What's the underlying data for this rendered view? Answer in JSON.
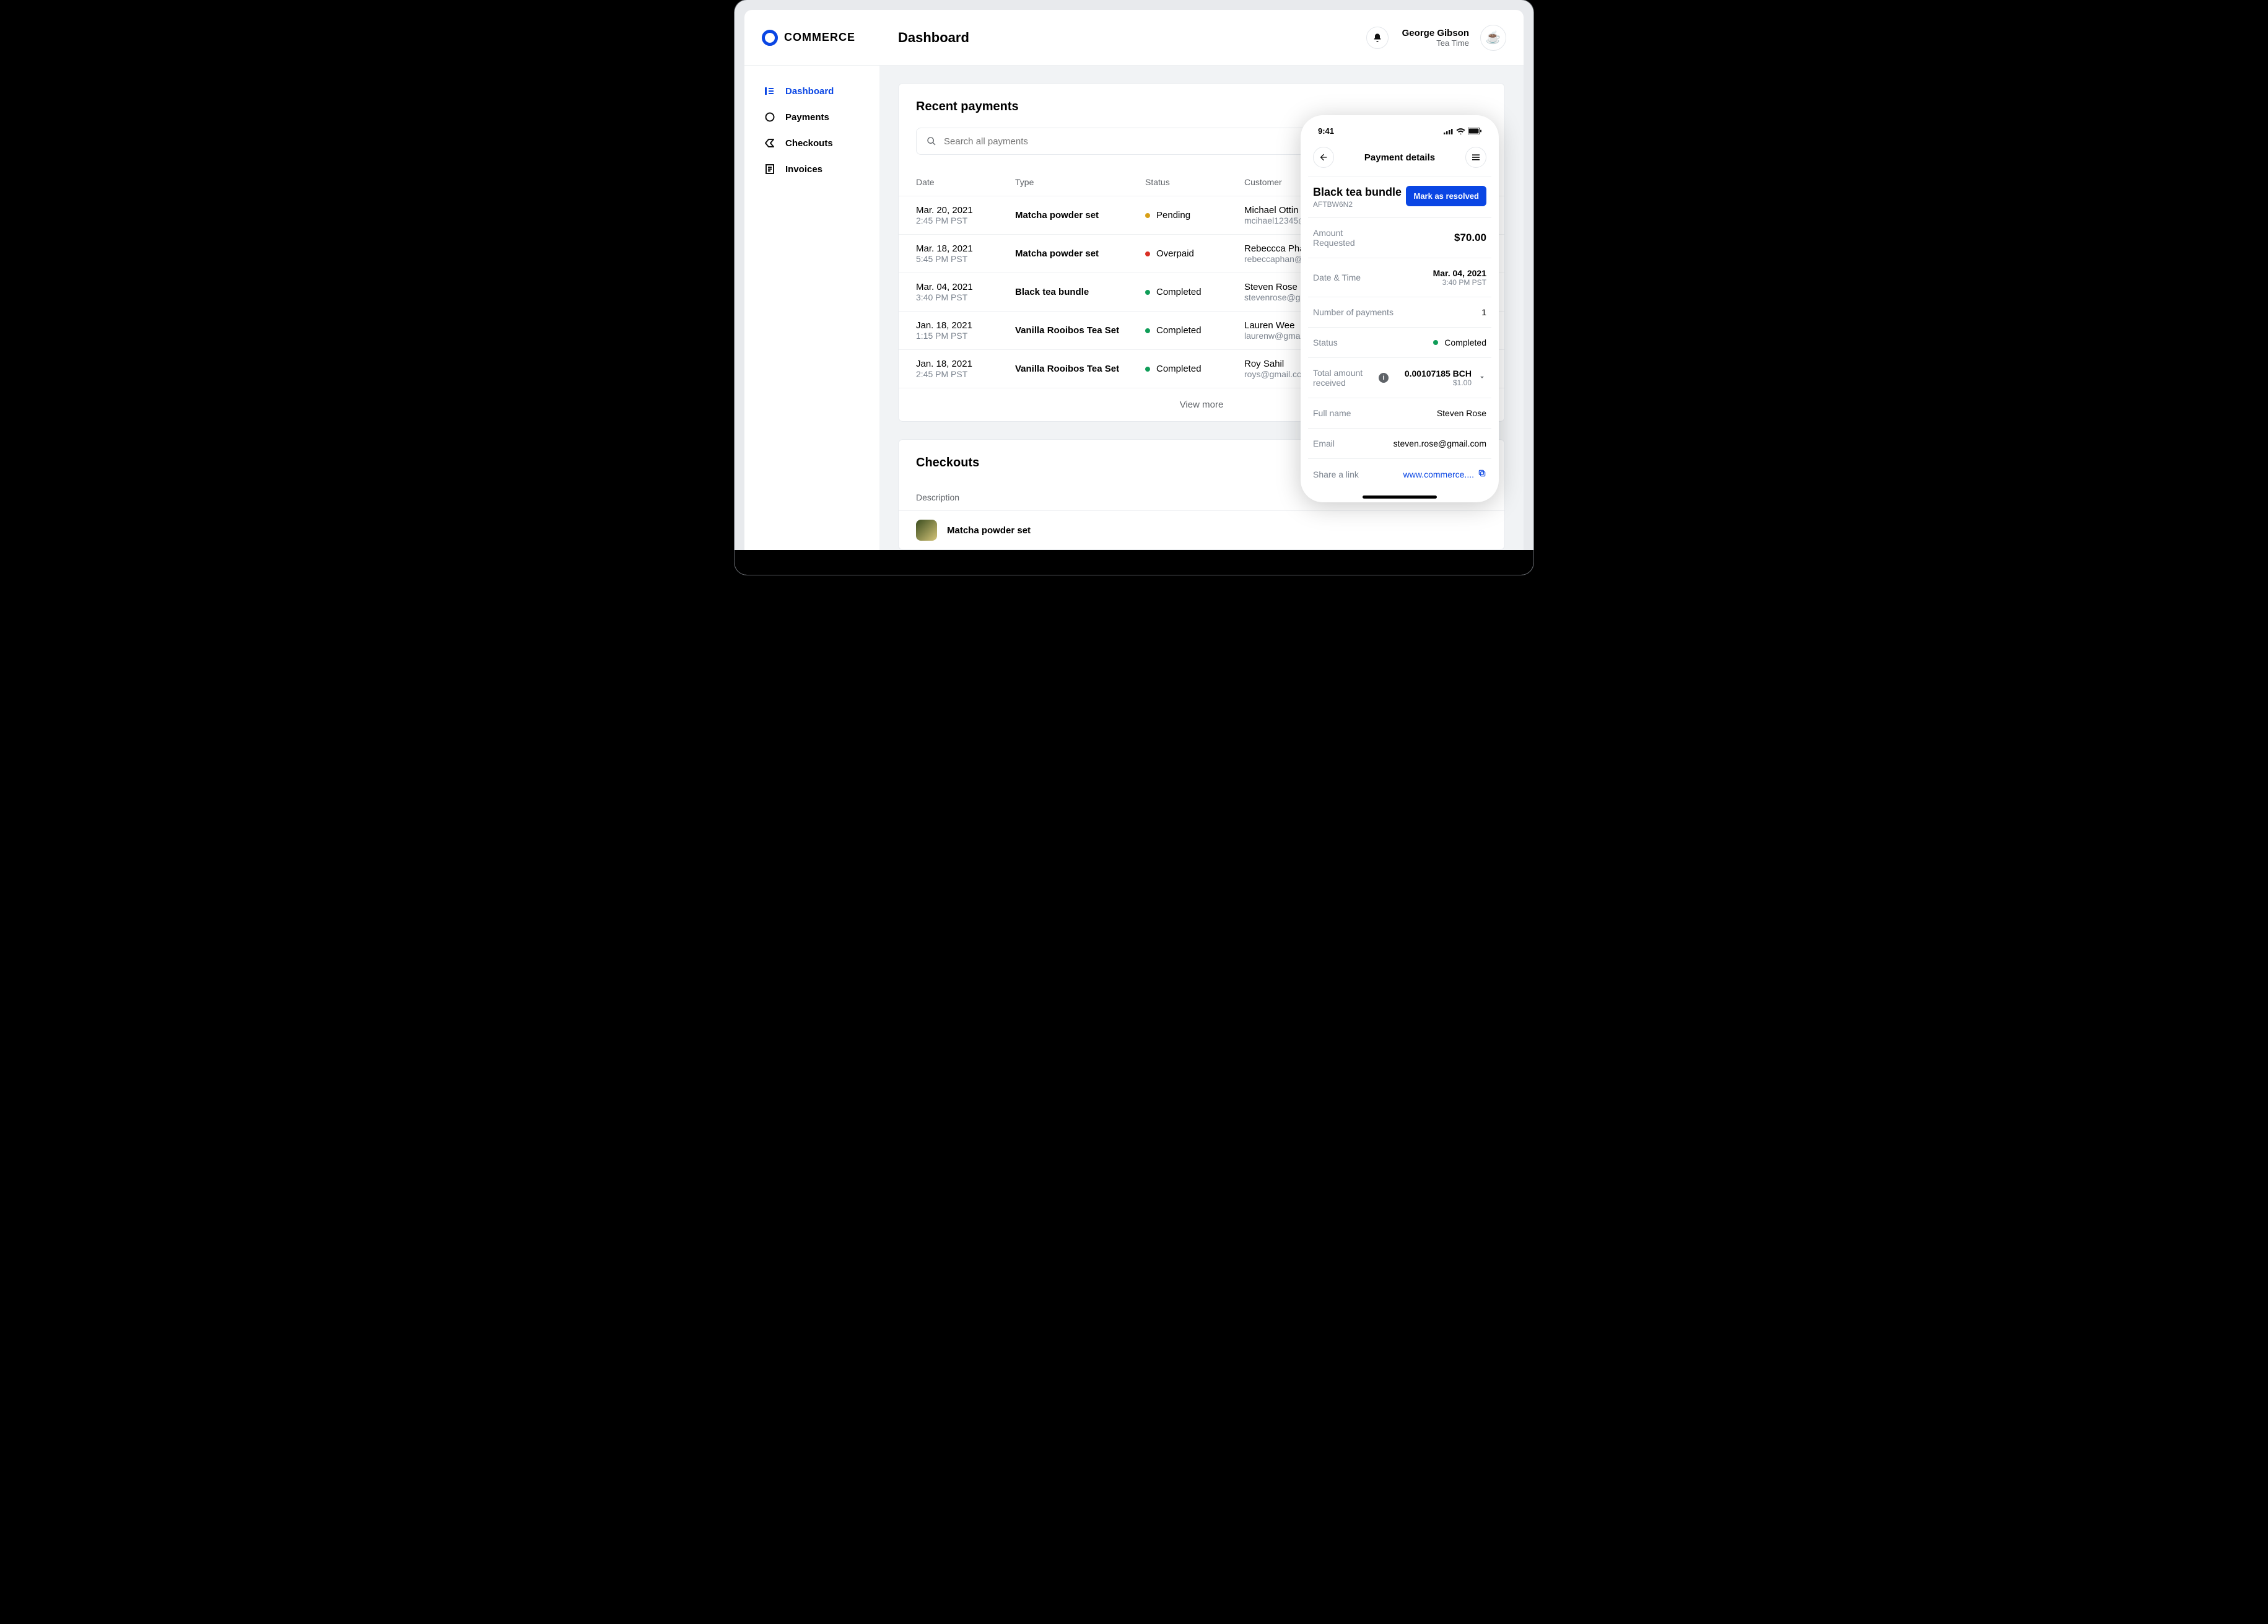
{
  "brand": "COMMERCE",
  "header": {
    "page_title": "Dashboard",
    "user_name": "George Gibson",
    "user_sub": "Tea Time"
  },
  "sidebar": {
    "items": [
      {
        "label": "Dashboard"
      },
      {
        "label": "Payments"
      },
      {
        "label": "Checkouts"
      },
      {
        "label": "Invoices"
      }
    ]
  },
  "recent": {
    "title": "Recent payments",
    "search_placeholder": "Search all payments",
    "columns": {
      "date": "Date",
      "type": "Type",
      "status": "Status",
      "customer": "Customer"
    },
    "rows": [
      {
        "date": "Mar. 20, 2021",
        "time": "2:45 PM PST",
        "type": "Matcha powder set",
        "status": "Pending",
        "status_kind": "pending",
        "cust_name": "Michael Ottin",
        "cust_email": "mcihael12345@"
      },
      {
        "date": "Mar. 18, 2021",
        "time": "5:45 PM PST",
        "type": "Matcha powder set",
        "status": "Overpaid",
        "status_kind": "overpaid",
        "cust_name": "Rebeccca Pha",
        "cust_email": "rebeccaphan@"
      },
      {
        "date": "Mar. 04, 2021",
        "time": "3:40 PM PST",
        "type": "Black tea bundle",
        "status": "Completed",
        "status_kind": "completed",
        "cust_name": "Steven Rose",
        "cust_email": "stevenrose@g"
      },
      {
        "date": "Jan. 18, 2021",
        "time": "1:15 PM PST",
        "type": "Vanilla Rooibos Tea Set",
        "status": "Completed",
        "status_kind": "completed",
        "cust_name": "Lauren Wee",
        "cust_email": "laurenw@gmai"
      },
      {
        "date": "Jan. 18, 2021",
        "time": "2:45 PM PST",
        "type": "Vanilla Rooibos Tea Set",
        "status": "Completed",
        "status_kind": "completed",
        "cust_name": "Roy Sahil",
        "cust_email": "roys@gmail.co"
      }
    ],
    "view_more": "View more"
  },
  "checkouts": {
    "title": "Checkouts",
    "cols": {
      "desc": "Description"
    },
    "rows": [
      {
        "name": "Matcha powder set"
      }
    ]
  },
  "phone": {
    "time": "9:41",
    "header": "Payment details",
    "product": "Black tea bundle",
    "code": "AFTBW6N2",
    "resolve": "Mark as resolved",
    "rows": {
      "amount_req": {
        "k": "Amount Requested",
        "v": "$70.00"
      },
      "datetime": {
        "k": "Date & Time",
        "v": "Mar. 04, 2021",
        "v2": "3:40 PM PST"
      },
      "numpay": {
        "k": "Number of payments",
        "v": "1"
      },
      "status": {
        "k": "Status",
        "v": "Completed"
      },
      "total": {
        "k": "Total amount received",
        "v": "0.00107185 BCH",
        "v2": "$1.00"
      },
      "fullname": {
        "k": "Full name",
        "v": "Steven Rose"
      },
      "email": {
        "k": "Email",
        "v": "steven.rose@gmail.com"
      },
      "share": {
        "k": "Share a link",
        "v": "www.commerce...."
      }
    }
  }
}
